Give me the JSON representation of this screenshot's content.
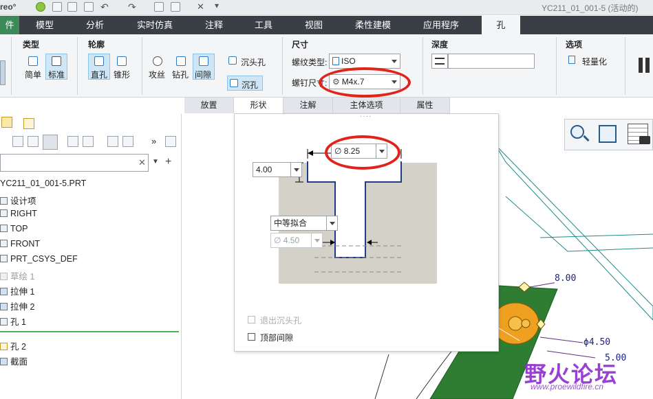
{
  "window": {
    "app_name_fragment": "reo°",
    "title": "YC211_01_001-5 (活动的)"
  },
  "ribbon_tabs": [
    {
      "label": "件"
    },
    {
      "label": "模型"
    },
    {
      "label": "分析"
    },
    {
      "label": "实时仿真"
    },
    {
      "label": "注释"
    },
    {
      "label": "工具"
    },
    {
      "label": "视图"
    },
    {
      "label": "柔性建模"
    },
    {
      "label": "应用程序"
    },
    {
      "label": "孔"
    }
  ],
  "ribbon": {
    "type_group": {
      "title": "类型",
      "simple": "简单",
      "standard": "标准"
    },
    "profile_group": {
      "title": "轮廓",
      "straight": "直孔",
      "taper": "锥形",
      "tap": "攻丝",
      "drill": "钻孔",
      "clearance": "间隙",
      "countersink": "沉头孔",
      "counterbore": "沉孔"
    },
    "dims_group": {
      "title": "尺寸",
      "thread_type_label": "螺纹类型:",
      "thread_type_value": "ISO",
      "screw_size_label": "螺钉尺寸:",
      "screw_size_value": "M4x.7"
    },
    "depth_group": {
      "title": "深度"
    },
    "options_group": {
      "title": "选项",
      "lightweight": "轻量化"
    }
  },
  "subtabs": [
    {
      "label": "放置"
    },
    {
      "label": "形状"
    },
    {
      "label": "注解"
    },
    {
      "label": "主体选项"
    },
    {
      "label": "属性"
    }
  ],
  "shape_panel": {
    "diameter_top": "8.25",
    "depth_value": "4.00",
    "fit_value": "中等拟合",
    "hole_diameter": "4.50",
    "exit_countersink_label": "退出沉头孔",
    "top_clearance_label": "顶部间隙"
  },
  "model_tree": {
    "root": "YC211_01_001-5.PRT",
    "items": [
      {
        "label": "设计项"
      },
      {
        "label": "RIGHT"
      },
      {
        "label": "TOP"
      },
      {
        "label": "FRONT"
      },
      {
        "label": "PRT_CSYS_DEF"
      },
      {
        "label": "草绘 1"
      },
      {
        "label": "拉伸 1"
      },
      {
        "label": "拉伸 2"
      },
      {
        "label": "孔 1"
      },
      {
        "label": "孔 2"
      },
      {
        "label": "截面"
      }
    ]
  },
  "viewport": {
    "dim_8": "8.00",
    "dim_45": "ϕ4.50",
    "dim_5": "5.00"
  },
  "watermark": {
    "cn": "野火论坛",
    "url": "www.proewildfire.cn"
  },
  "colors": {
    "ribbon_dark": "#3a3f45",
    "accent_red": "#e2231a",
    "part_green": "#2e7d32",
    "hole_orange": "#f0a020"
  }
}
